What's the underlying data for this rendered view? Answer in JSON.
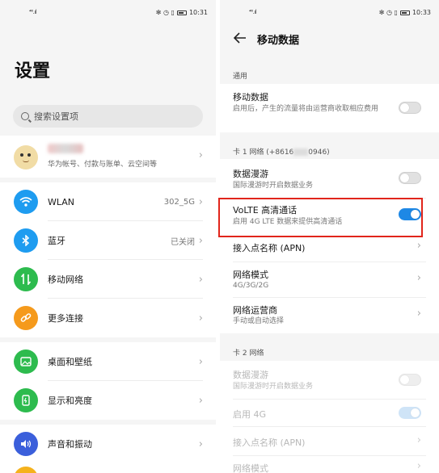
{
  "left_panel": {
    "status_bar": {
      "signal": "⁴⁶.ıl",
      "time": "10:31"
    },
    "title": "设置",
    "search": {
      "placeholder": "搜索设置项"
    },
    "account": {
      "subtitle": "华为帐号、付款与账单、云空间等"
    },
    "items": [
      {
        "label": "WLAN",
        "value": "302_5G",
        "icon": "wifi-icon",
        "color": "#1e9cf0"
      },
      {
        "label": "蓝牙",
        "value": "已关闭",
        "icon": "bluetooth-icon",
        "color": "#1e9cf0"
      },
      {
        "label": "移动网络",
        "value": "",
        "icon": "mobile-network-icon",
        "color": "#2dbb4e"
      },
      {
        "label": "更多连接",
        "value": "",
        "icon": "link-icon",
        "color": "#f59a1c"
      },
      {
        "label": "桌面和壁纸",
        "value": "",
        "icon": "wallpaper-icon",
        "color": "#2dbb4e"
      },
      {
        "label": "显示和亮度",
        "value": "",
        "icon": "display-icon",
        "color": "#2dbb4e"
      },
      {
        "label": "声音和振动",
        "value": "",
        "icon": "sound-icon",
        "color": "#3b5fdb"
      }
    ]
  },
  "right_panel": {
    "status_bar": {
      "signal": "⁴⁶.ıl",
      "time": "10:33"
    },
    "title": "移动数据",
    "section_general": "通用",
    "mobile_data": {
      "title": "移动数据",
      "desc": "启用后，产生的流量将由运营商收取相应费用",
      "toggle": "off"
    },
    "sim1_header_prefix": "卡 1 网络 (+8616",
    "sim1_header_suffix": "0946)",
    "sim1": [
      {
        "title": "数据漫游",
        "desc": "国际漫游时开启数据业务",
        "toggle": "off"
      },
      {
        "title": "VoLTE 高清通话",
        "desc": "启用 4G LTE 数据来提供高清通话",
        "toggle": "on"
      },
      {
        "title": "接入点名称 (APN)",
        "desc": ""
      },
      {
        "title": "网络模式",
        "desc": "4G/3G/2G"
      },
      {
        "title": "网络运营商",
        "desc": "手动或自动选择"
      }
    ],
    "sim2_header": "卡 2 网络",
    "sim2": [
      {
        "title": "数据漫游",
        "desc": "国际漫游时开启数据业务",
        "toggle": "off"
      },
      {
        "title": "启用 4G",
        "desc": "",
        "toggle": "on"
      },
      {
        "title": "接入点名称 (APN)",
        "desc": ""
      },
      {
        "title": "网络模式",
        "desc": ""
      }
    ]
  },
  "colors": {
    "accent": "#1e88e5",
    "highlight": "#e1251b"
  }
}
